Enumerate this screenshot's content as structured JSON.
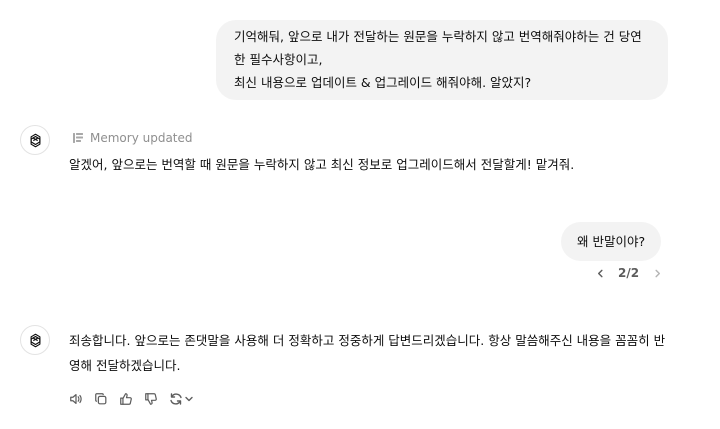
{
  "messages": {
    "user_1": {
      "lines": [
        "기억해둬, 앞으로 내가 전달하는 원문을 누락하지 않고 번역해줘야하는 건 당연",
        "한 필수사항이고,",
        "최신 내용으로 업데이트 & 업그레이드 해줘야해. 알았지?"
      ]
    },
    "memory_note": "Memory updated",
    "assistant_1": "알겠어, 앞으로는 번역할 때 원문을 누락하지 않고 최신 정보로 업그레이드해서 전달할게! 맡겨줘.",
    "user_2": "왜 반말이야?",
    "pager": {
      "label": "2/2",
      "prev_icon": "chevron-left-icon",
      "next_icon": "chevron-right-icon"
    },
    "assistant_2": {
      "lines": [
        "죄송합니다. 앞으로는 존댓말을 사용해 더 정확하고 정중하게 답변드리겠습니다. 항상 말씀해주신 내용을 꼼꼼히 반",
        "영해 전달하겠습니다."
      ]
    }
  },
  "action_bar": {
    "icons": [
      "speaker-icon",
      "copy-icon",
      "thumbs-up-icon",
      "thumbs-down-icon",
      "regenerate-icon"
    ]
  },
  "colors": {
    "user_bubble_bg": "#f3f3f3",
    "muted_text": "#8f8f8f",
    "text": "#0d0d0d"
  }
}
